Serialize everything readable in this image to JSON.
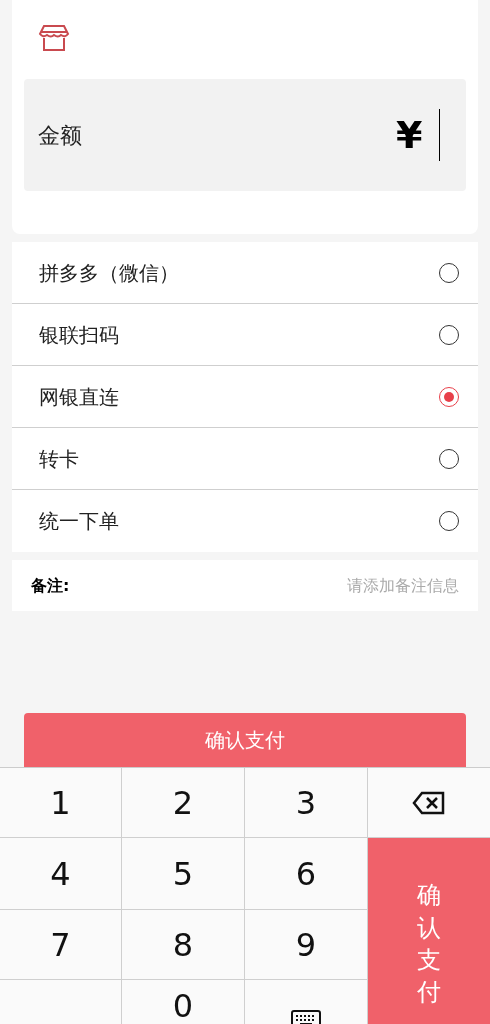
{
  "amount": {
    "label": "金额",
    "currency": "¥"
  },
  "payment_methods": [
    {
      "label": "拼多多（微信）",
      "selected": false
    },
    {
      "label": "银联扫码",
      "selected": false
    },
    {
      "label": "网银直连",
      "selected": true
    },
    {
      "label": "转卡",
      "selected": false
    },
    {
      "label": "统一下单",
      "selected": false
    }
  ],
  "note": {
    "label": "备注:",
    "placeholder": "请添加备注信息"
  },
  "confirm_button": "确认支付",
  "keypad": [
    {
      "kind": "digit",
      "label": "1"
    },
    {
      "kind": "digit",
      "label": "2"
    },
    {
      "kind": "digit",
      "label": "3"
    },
    {
      "kind": "backspace"
    },
    {
      "kind": "digit",
      "label": "4"
    },
    {
      "kind": "digit",
      "label": "5"
    },
    {
      "kind": "digit",
      "label": "6"
    },
    {
      "kind": "digit",
      "label": "7"
    },
    {
      "kind": "digit",
      "label": "8"
    },
    {
      "kind": "digit",
      "label": "9"
    },
    {
      "kind": "blank"
    },
    {
      "kind": "digit",
      "label": "0"
    },
    {
      "kind": "keyboard"
    },
    {
      "kind": "confirm",
      "label": "确认支付"
    }
  ]
}
